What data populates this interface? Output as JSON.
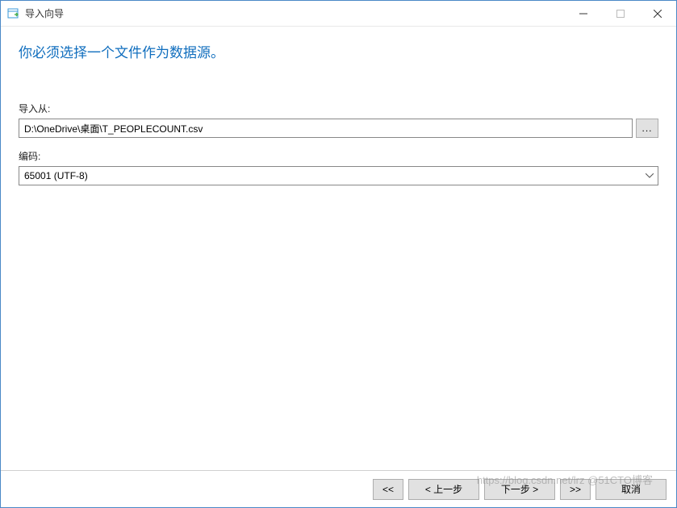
{
  "window": {
    "title": "导入向导"
  },
  "instruction": "你必须选择一个文件作为数据源。",
  "fields": {
    "import_from_label": "导入从:",
    "import_from_value": "D:\\OneDrive\\桌面\\T_PEOPLECOUNT.csv",
    "browse_label": "...",
    "encoding_label": "编码:",
    "encoding_value": "65001 (UTF-8)"
  },
  "footer": {
    "first": "<<",
    "prev": "< 上一步",
    "next": "下一步 >",
    "last": ">>",
    "cancel": "取消"
  },
  "watermark": "https://blog.csdn.net/lrz @51CTO博客"
}
